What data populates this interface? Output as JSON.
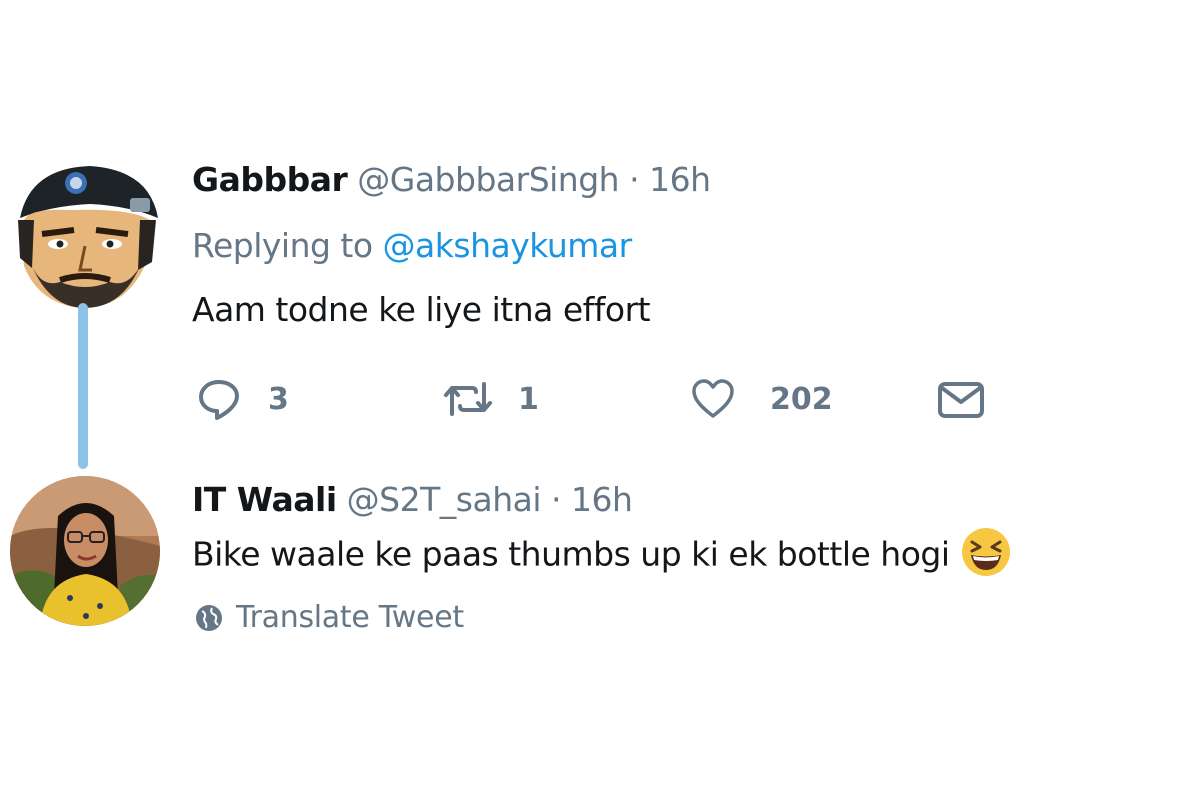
{
  "tweet1": {
    "name": "Gabbbar",
    "handle": "@GabbbarSingh",
    "separator": "·",
    "time": "16h",
    "replying_prefix": "Replying to ",
    "replying_to": "@akshaykumar",
    "text": "Aam todne ke liye itna effort",
    "actions": {
      "reply_count": "3",
      "retweet_count": "1",
      "like_count": "202"
    },
    "icons": [
      "reply-icon",
      "retweet-icon",
      "heart-icon",
      "envelope-icon"
    ]
  },
  "tweet2": {
    "name": "IT Waali",
    "handle": "@S2T_sahai",
    "separator": "·",
    "time": "16h",
    "text": "Bike waale ke paas thumbs up ki ek bottle hogi",
    "emoji": "grinning-squinting-face",
    "translate_label": "Translate Tweet"
  },
  "colors": {
    "link": "#1b95e0",
    "muted": "#657786",
    "text": "#14171a",
    "thread_line": "#8dc3e8"
  }
}
